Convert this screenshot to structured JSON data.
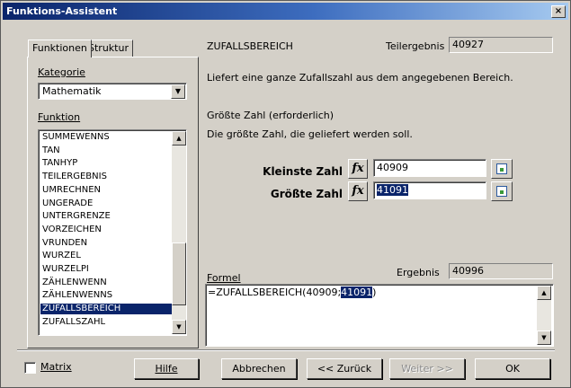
{
  "window": {
    "title": "Funktions-Assistent",
    "close_glyph": "×"
  },
  "tabs": [
    {
      "label": "Funktionen"
    },
    {
      "label": "Struktur"
    }
  ],
  "left": {
    "category_label": "Kategorie",
    "category_value": "Mathematik",
    "function_label": "Funktion",
    "functions": [
      "SUMMEWENNS",
      "TAN",
      "TANHYP",
      "TEILERGEBNIS",
      "UMRECHNEN",
      "UNGERADE",
      "UNTERGRENZE",
      "VORZEICHEN",
      "VRUNDEN",
      "WURZEL",
      "WURZELPI",
      "ZÄHLENWENN",
      "ZÄHLENWENNS",
      "ZUFALLSBEREICH",
      "ZUFALLSZAHL"
    ],
    "selected_function": "ZUFALLSBEREICH",
    "matrix_label": "Matrix"
  },
  "right": {
    "function_name": "ZUFALLSBEREICH",
    "partial_result_label": "Teilergebnis",
    "partial_result_value": "40927",
    "description": "Liefert eine ganze Zufallszahl aus dem angegebenen Bereich.",
    "arg_title": "Größte Zahl (erforderlich)",
    "arg_description": "Die größte Zahl, die geliefert werden soll.",
    "args": [
      {
        "label": "Kleinste Zahl",
        "value": "40909"
      },
      {
        "label": "Größte Zahl",
        "value": "41091"
      }
    ],
    "fx_glyph": "fx",
    "formula_label": "Formel",
    "result_label": "Ergebnis",
    "result_value": "40996",
    "formula_prefix": "=ZUFALLSBEREICH(40909;",
    "formula_selected": "41091",
    "formula_suffix": ")"
  },
  "buttons": {
    "help": "Hilfe",
    "cancel": "Abbrechen",
    "back": "<< Zurück",
    "next": "Weiter >>",
    "ok": "OK"
  }
}
